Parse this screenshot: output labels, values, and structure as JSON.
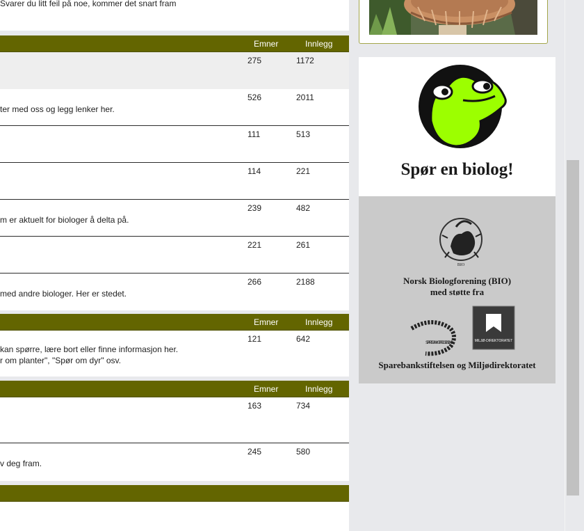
{
  "colors": {
    "header_bg": "#636500",
    "panel_bg": "#ffffff",
    "page_bg": "#e8e9ec",
    "sponsor_bg": "#cacaca",
    "frog_green": "#9cff00"
  },
  "intro": {
    "text": "Svarer du litt feil på noe, kommer det snart fram"
  },
  "sections": [
    {
      "header": {
        "col_topics": "Emner",
        "col_posts": "Innlegg"
      },
      "rows": [
        {
          "desc": "",
          "topics": "275",
          "posts": "1172"
        },
        {
          "desc": "ter med oss og legg lenker her.",
          "topics": "526",
          "posts": "2011"
        },
        {
          "desc": "",
          "topics": "111",
          "posts": "513"
        },
        {
          "desc": "",
          "topics": "114",
          "posts": "221"
        },
        {
          "desc": "m er aktuelt for biologer å delta på.",
          "topics": "239",
          "posts": "482"
        },
        {
          "desc": "",
          "topics": "221",
          "posts": "261"
        },
        {
          "desc": " med andre biologer. Her er stedet.",
          "topics": "266",
          "posts": "2188"
        }
      ]
    },
    {
      "header": {
        "col_topics": "Emner",
        "col_posts": "Innlegg"
      },
      "rows": [
        {
          "desc": "kan spørre, lære bort eller finne informasjon her.",
          "desc2": "r om planter\", \"Spør om dyr\" osv.",
          "topics": "121",
          "posts": "642"
        }
      ]
    },
    {
      "header": {
        "col_topics": "Emner",
        "col_posts": "Innlegg"
      },
      "rows": [
        {
          "desc": "",
          "topics": "163",
          "posts": "734"
        },
        {
          "desc": "v deg fram.",
          "topics": "245",
          "posts": "580"
        }
      ]
    }
  ],
  "sidebar": {
    "ask_title": "Spør en biolog!",
    "bio_logo_text": "BIO",
    "sponsor_org": "Norsk Biologforening (BIO)",
    "sponsor_sub": "med støtte fra",
    "spb_logo_text": "SPAREBANKSTIFTELSEN DNB",
    "miljo_logo_text": "MILJØ-DIREKTORATET",
    "sponsor_bottom": "Sparebankstiftelsen og Miljødirektoratet"
  }
}
